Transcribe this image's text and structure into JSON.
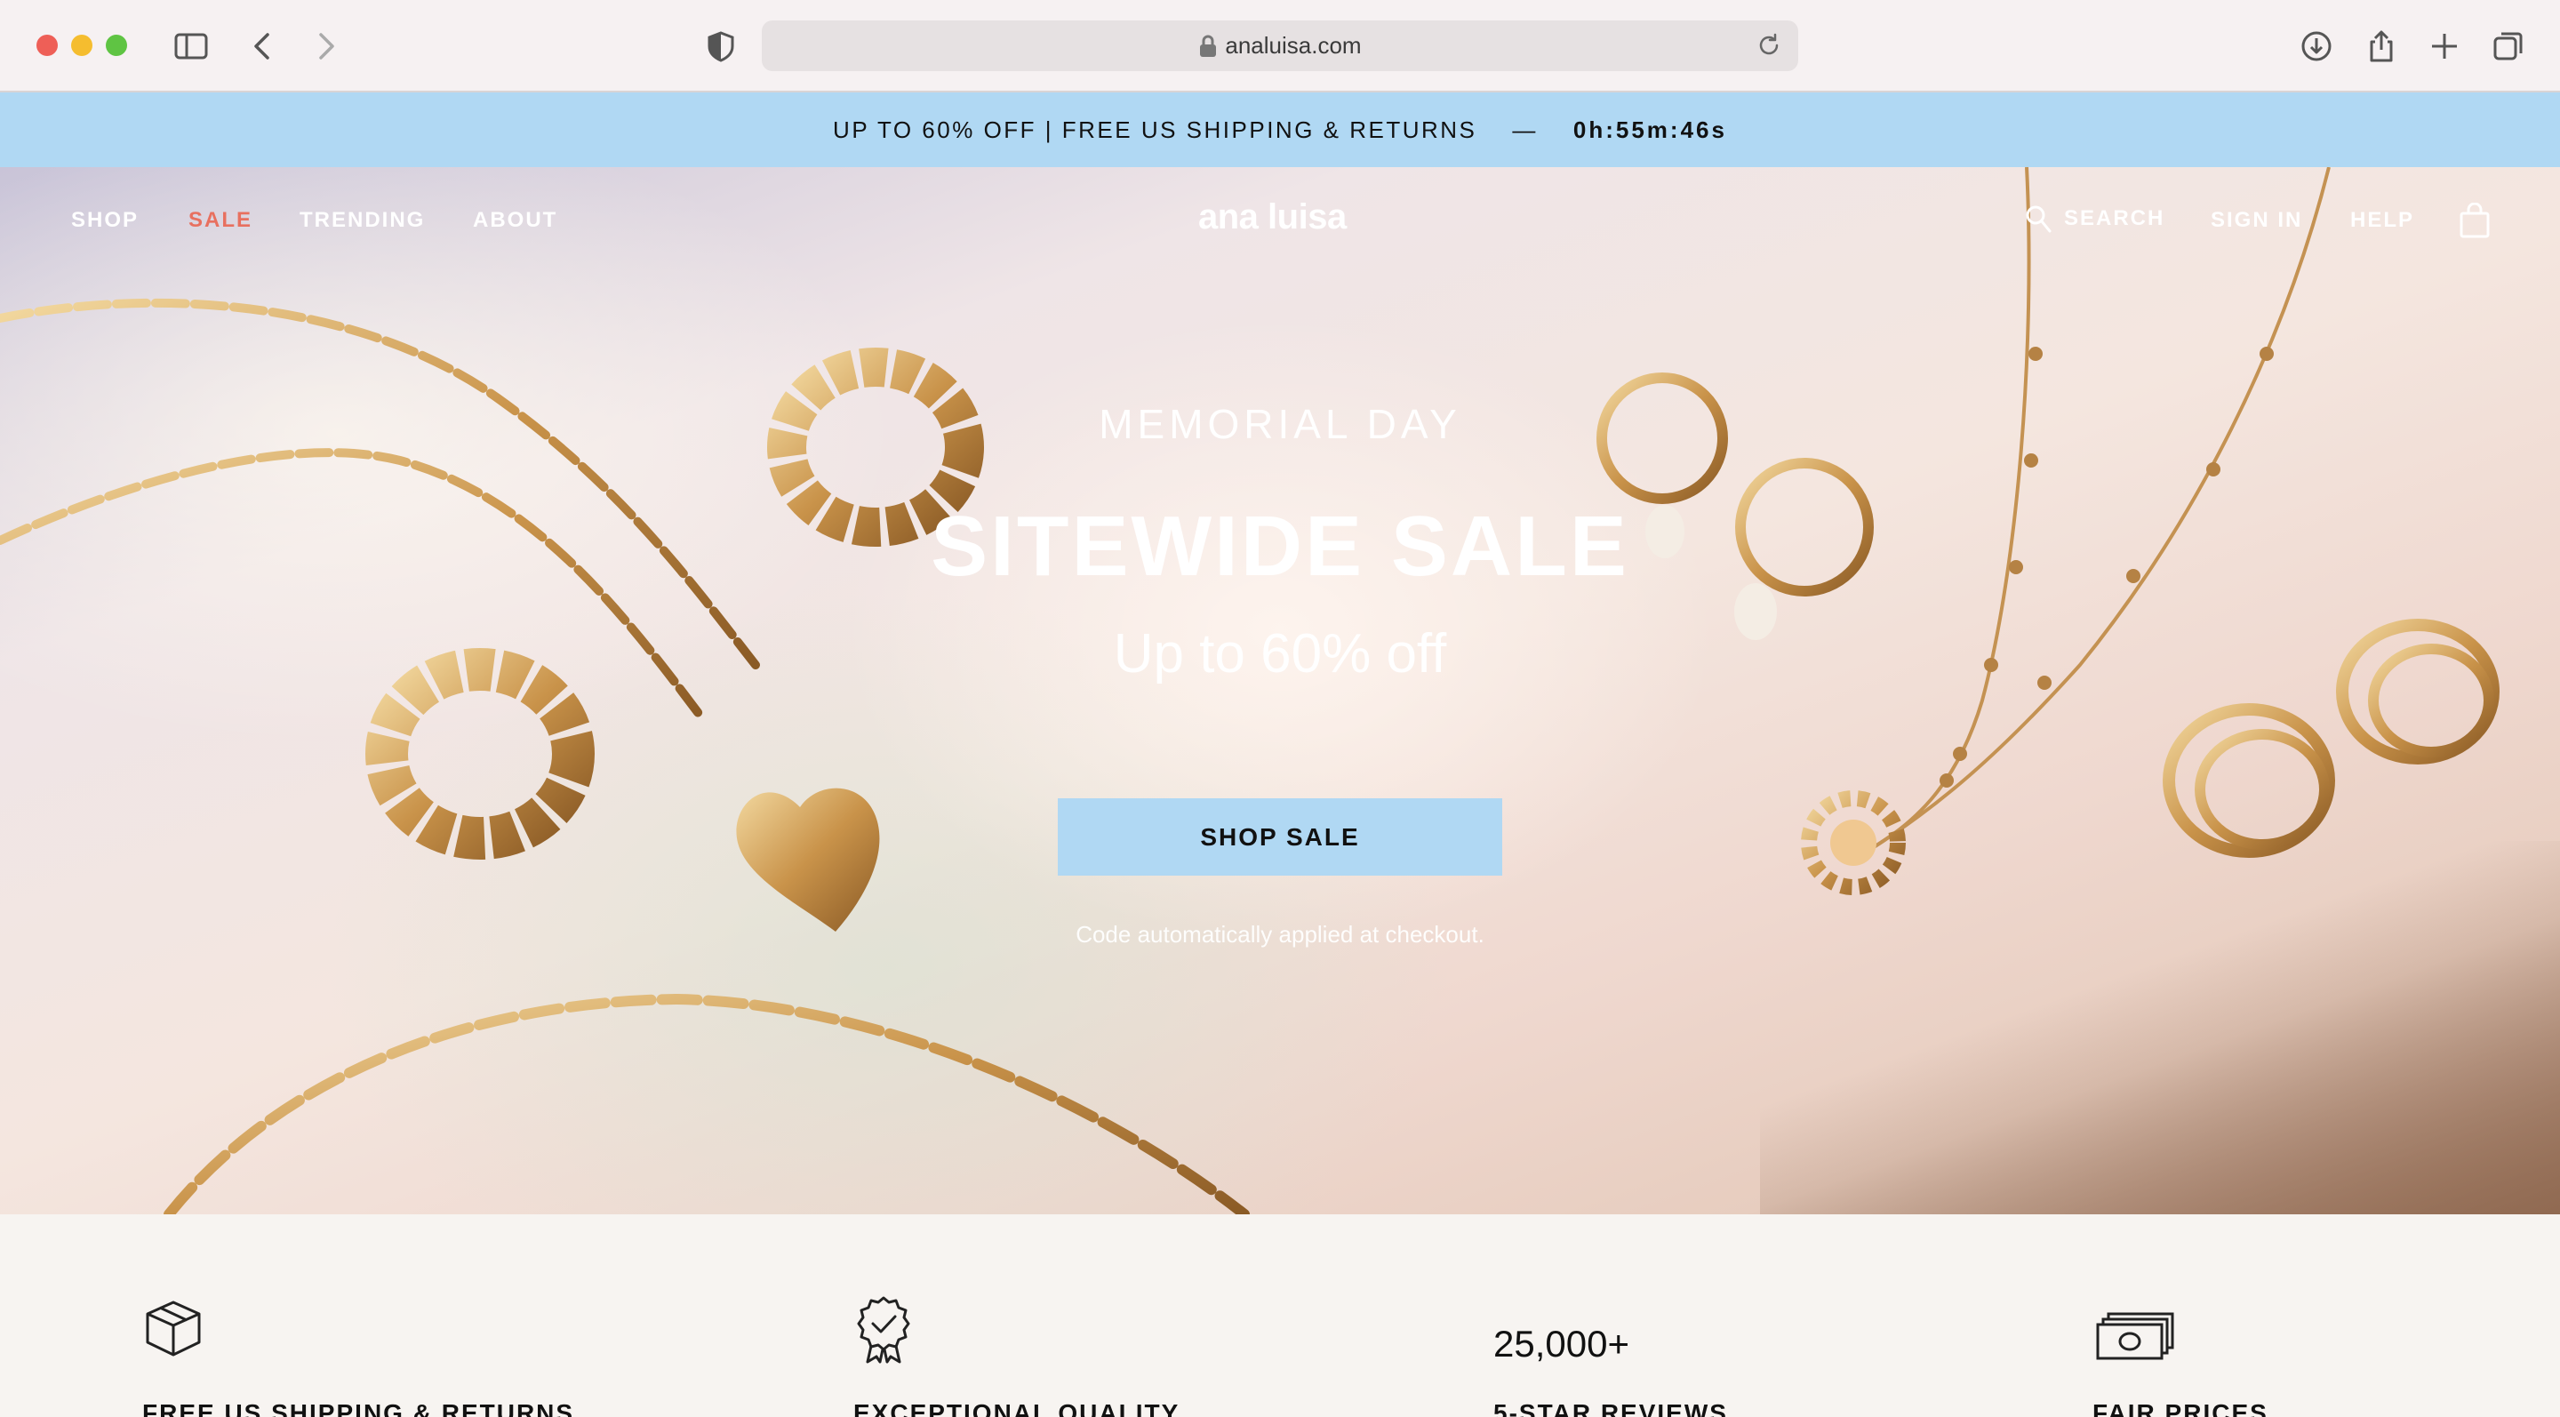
{
  "browser": {
    "url": "analuisa.com"
  },
  "promo": {
    "text": "UP TO 60% OFF | FREE US SHIPPING & RETURNS",
    "dash": "—",
    "timer": "0h:55m:46s"
  },
  "nav": {
    "shop": "SHOP",
    "sale": "SALE",
    "trending": "TRENDING",
    "about": "ABOUT",
    "logo": "ana luisa",
    "search": "SEARCH",
    "sign_in": "SIGN IN",
    "help": "HELP"
  },
  "hero": {
    "kicker": "MEMORIAL DAY",
    "title": "SITEWIDE SALE",
    "subtitle": "Up to 60% off",
    "cta": "SHOP SALE",
    "note": "Code automatically applied at checkout."
  },
  "features": {
    "shipping": "FREE US SHIPPING & RETURNS",
    "quality": "EXCEPTIONAL QUALITY",
    "reviews_count": "25,000+",
    "reviews": "5-STAR REVIEWS",
    "prices": "FAIR PRICES"
  },
  "colors": {
    "promo_bg": "#b0d8f3",
    "sale_accent": "#e8705f"
  }
}
